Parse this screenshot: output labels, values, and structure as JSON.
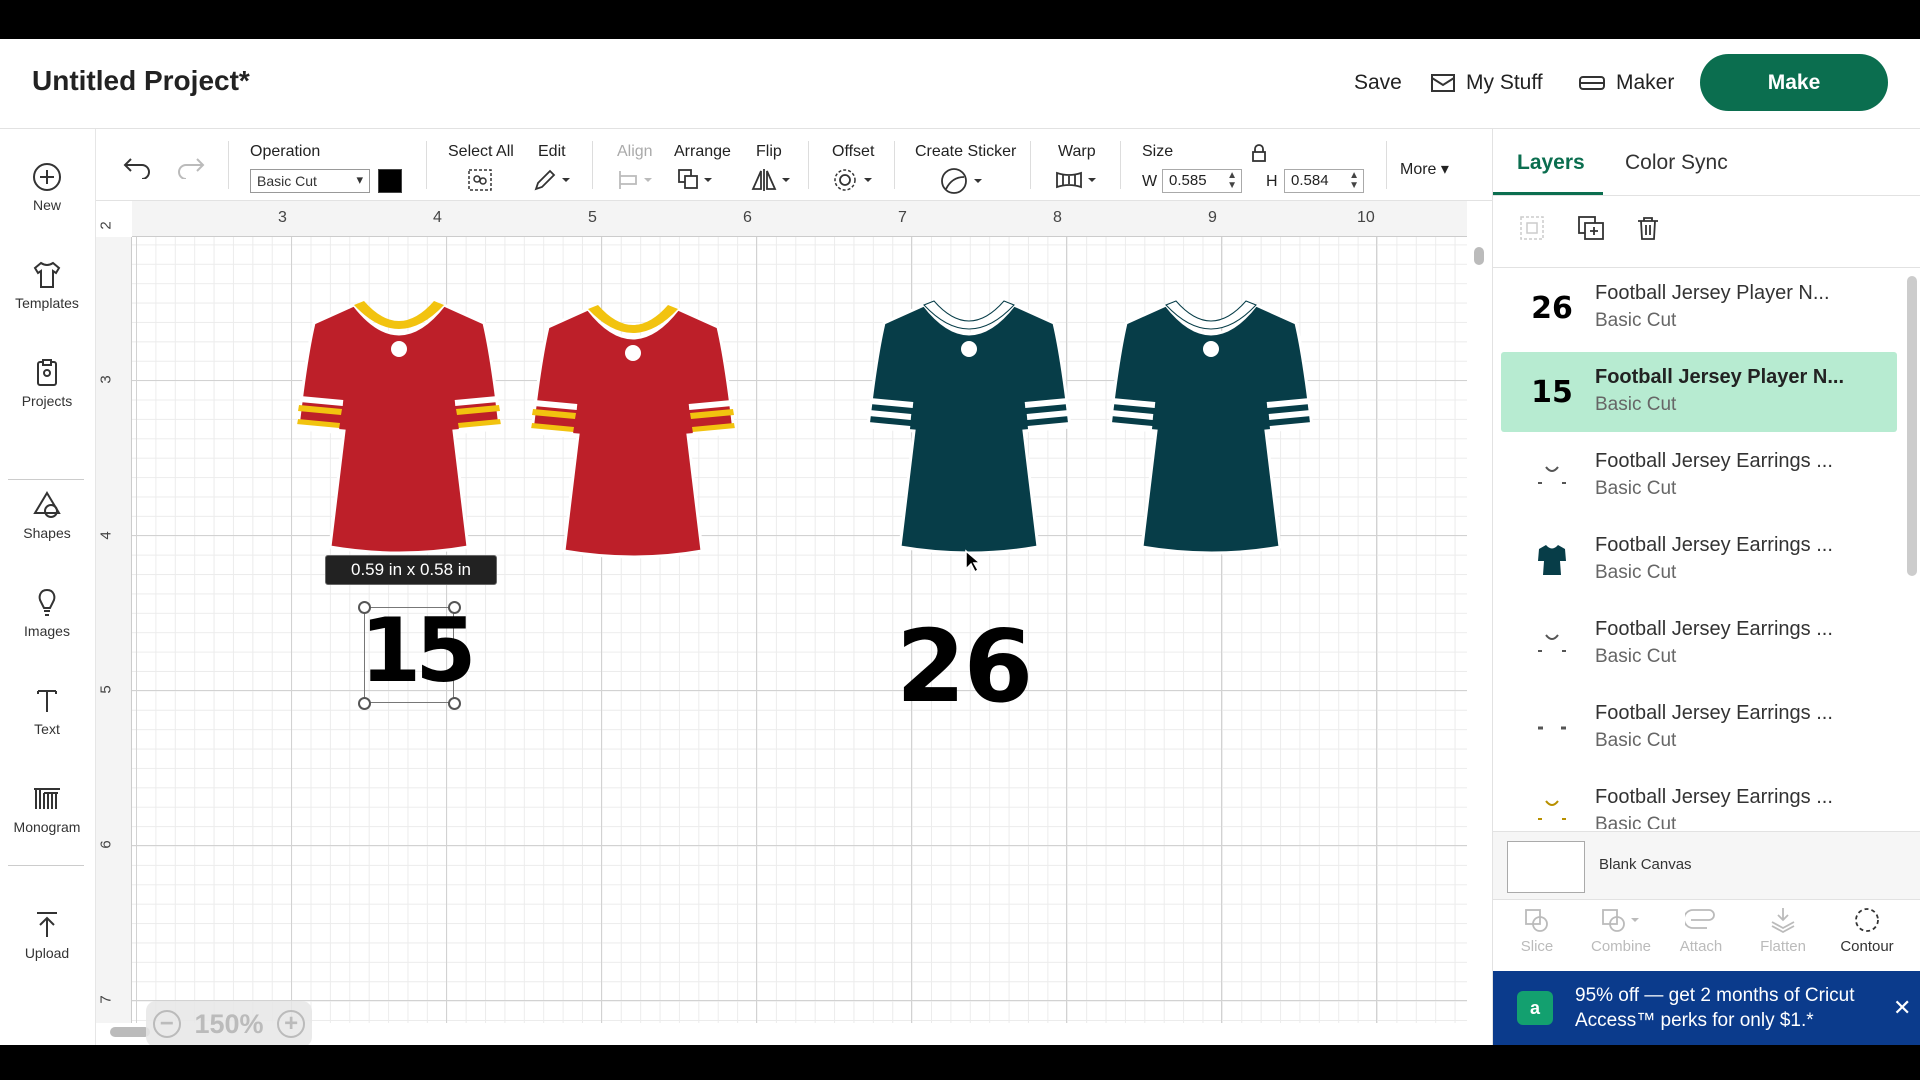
{
  "header": {
    "title": "Untitled Project*",
    "save_label": "Save",
    "mystuff_label": "My Stuff",
    "maker_label": "Maker",
    "make_label": "Make"
  },
  "sidebar": {
    "items": [
      {
        "label": "New",
        "icon": "plus-circle-icon"
      },
      {
        "label": "Templates",
        "icon": "tshirt-icon"
      },
      {
        "label": "Projects",
        "icon": "clipboard-icon"
      },
      {
        "label": "Shapes",
        "icon": "shapes-icon"
      },
      {
        "label": "Images",
        "icon": "lightbulb-icon"
      },
      {
        "label": "Text",
        "icon": "text-icon"
      },
      {
        "label": "Monogram",
        "icon": "monogram-icon"
      },
      {
        "label": "Upload",
        "icon": "upload-icon"
      }
    ]
  },
  "toolbar": {
    "operation_label": "Operation",
    "operation_value": "Basic Cut",
    "operation_color": "#000000",
    "select_all_label": "Select All",
    "edit_label": "Edit",
    "align_label": "Align",
    "arrange_label": "Arrange",
    "flip_label": "Flip",
    "offset_label": "Offset",
    "create_sticker_label": "Create Sticker",
    "warp_label": "Warp",
    "size_label": "Size",
    "w_label": "W",
    "w_value": "0.585",
    "h_label": "H",
    "h_value": "0.584",
    "more_label": "More"
  },
  "canvas": {
    "ruler_top": [
      "3",
      "4",
      "5",
      "6",
      "7",
      "8",
      "9",
      "10"
    ],
    "ruler_left": [
      "2",
      "3",
      "4",
      "5",
      "6",
      "7"
    ],
    "tooltip": "0.59  in x 0.58  in",
    "numbers": [
      "15",
      "26"
    ],
    "zoom": "150%",
    "colors": {
      "red_jersey": "#bd1f29",
      "gold": "#f2c30f",
      "green_jersey": "#073d48",
      "white": "#ffffff"
    }
  },
  "panel": {
    "tabs": [
      "Layers",
      "Color Sync"
    ],
    "layers": [
      {
        "thumb": "26",
        "name": "Football Jersey Player N...",
        "op": "Basic Cut",
        "selected": false
      },
      {
        "thumb": "15",
        "name": "Football Jersey Player N...",
        "op": "Basic Cut",
        "selected": true
      },
      {
        "thumb": "collar-white",
        "name": "Football Jersey Earrings ...",
        "op": "Basic Cut",
        "selected": false
      },
      {
        "thumb": "jersey-green",
        "name": "Football Jersey Earrings ...",
        "op": "Basic Cut",
        "selected": false
      },
      {
        "thumb": "collar-white",
        "name": "Football Jersey Earrings ...",
        "op": "Basic Cut",
        "selected": false
      },
      {
        "thumb": "stripes",
        "name": "Football Jersey Earrings ...",
        "op": "Basic Cut",
        "selected": false
      },
      {
        "thumb": "collar-gold",
        "name": "Football Jersey Earrings ...",
        "op": "Basic Cut",
        "selected": false
      }
    ],
    "blank_canvas": "Blank Canvas",
    "actions": [
      "Slice",
      "Combine",
      "Attach",
      "Flatten",
      "Contour"
    ],
    "promo_text": "95% off — get 2 months of Cricut Access™ perks for only $1.*"
  }
}
